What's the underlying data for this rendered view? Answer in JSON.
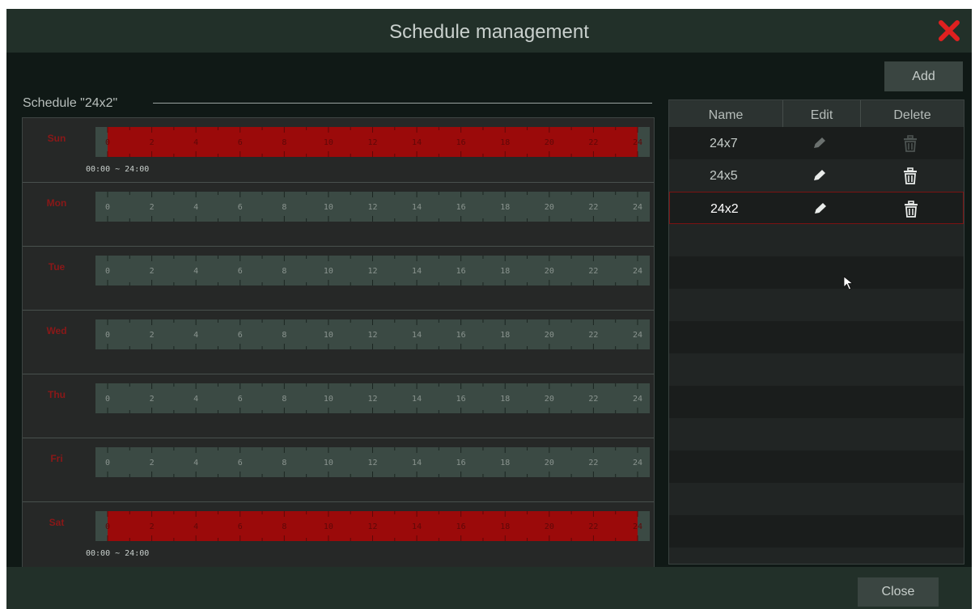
{
  "dialog": {
    "title": "Schedule management",
    "close_icon": "close-icon",
    "accent_color": "#e02020"
  },
  "schedule": {
    "label": "Schedule \"24x2\"",
    "tick_labels": [
      "0",
      "2",
      "4",
      "6",
      "8",
      "10",
      "12",
      "14",
      "16",
      "18",
      "20",
      "22",
      "24"
    ],
    "days": [
      {
        "name": "Sun",
        "scheduled": true,
        "range": "00:00 ~ 24:00"
      },
      {
        "name": "Mon",
        "scheduled": false,
        "range": ""
      },
      {
        "name": "Tue",
        "scheduled": false,
        "range": ""
      },
      {
        "name": "Wed",
        "scheduled": false,
        "range": ""
      },
      {
        "name": "Thu",
        "scheduled": false,
        "range": ""
      },
      {
        "name": "Fri",
        "scheduled": false,
        "range": ""
      },
      {
        "name": "Sat",
        "scheduled": true,
        "range": "00:00 ~ 24:00"
      }
    ]
  },
  "list": {
    "add_label": "Add",
    "columns": [
      "Name",
      "Edit",
      "Delete"
    ],
    "rows": [
      {
        "name": "24x7",
        "editable": false,
        "deletable": false,
        "selected": false
      },
      {
        "name": "24x5",
        "editable": true,
        "deletable": true,
        "selected": false
      },
      {
        "name": "24x2",
        "editable": true,
        "deletable": true,
        "selected": true
      }
    ],
    "edit_icon": "pencil-icon",
    "delete_icon": "trash-icon"
  },
  "footer": {
    "close_label": "Close"
  }
}
